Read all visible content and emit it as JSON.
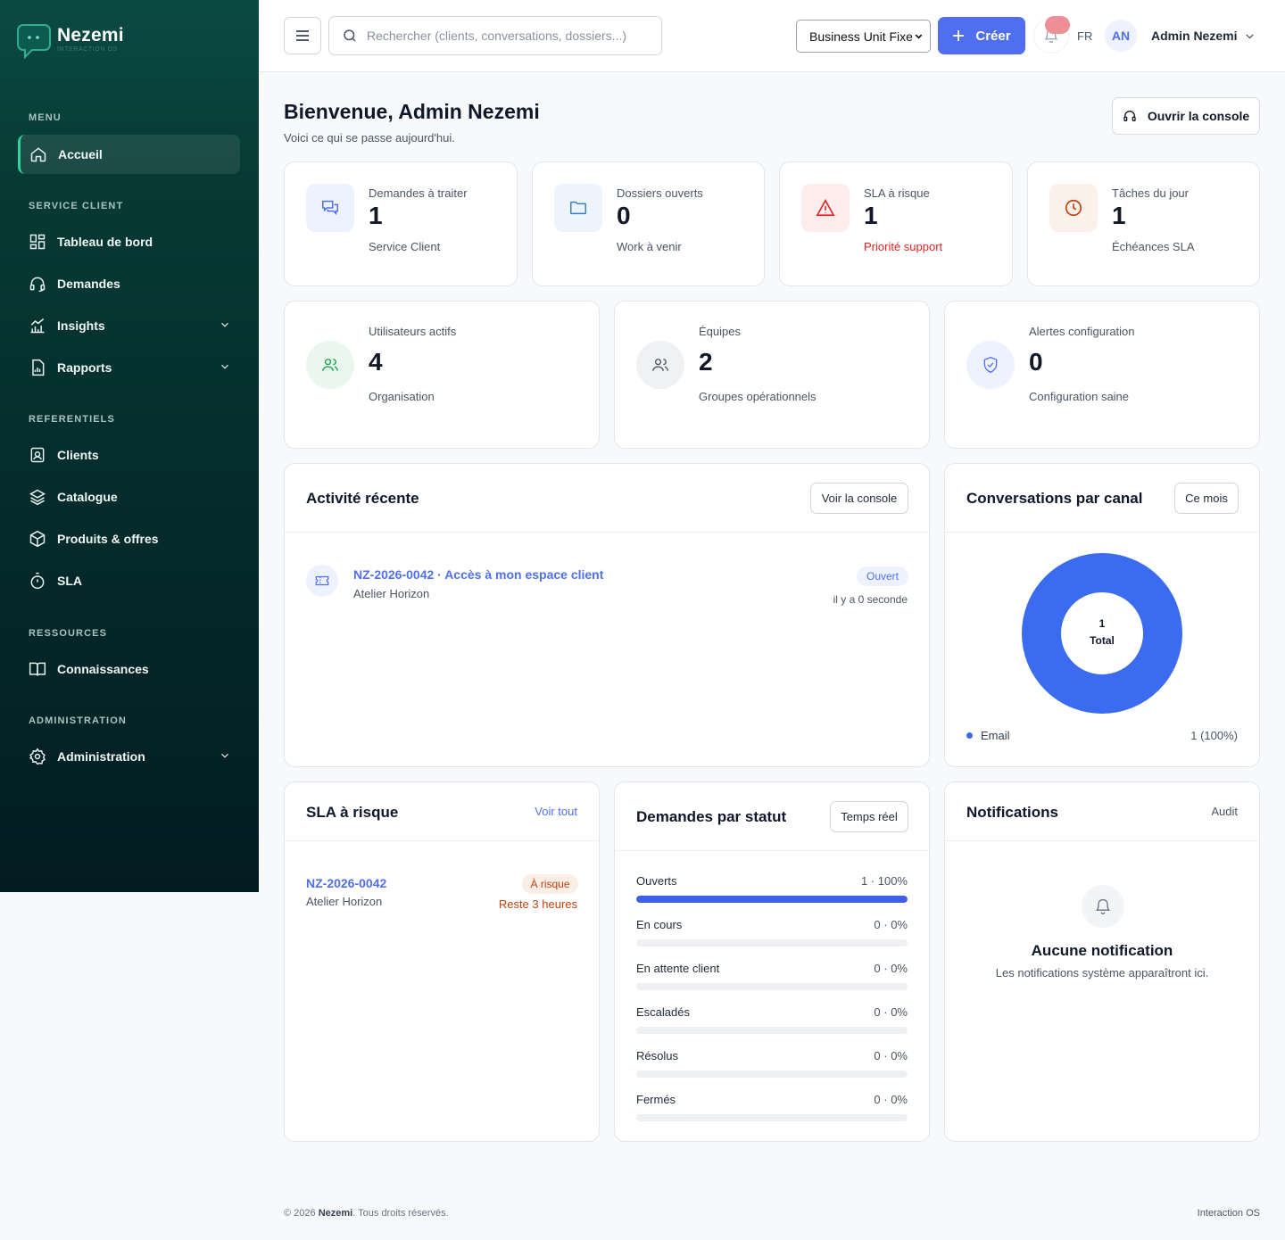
{
  "brand": {
    "name": "Nezemi",
    "tagline": "INTERACTION OS"
  },
  "sidebar": {
    "sections": {
      "menu": "MENU",
      "service": "SERVICE CLIENT",
      "ref": "REFERENTIELS",
      "res": "RESSOURCES",
      "admin": "ADMINISTRATION"
    },
    "items": {
      "accueil": "Accueil",
      "tableau": "Tableau de bord",
      "demandes": "Demandes",
      "insights": "Insights",
      "rapports": "Rapports",
      "clients": "Clients",
      "catalogue": "Catalogue",
      "produits": "Produits & offres",
      "sla": "SLA",
      "connaissances": "Connaissances",
      "administration": "Administration"
    }
  },
  "topbar": {
    "search_placeholder": "Rechercher (clients, conversations, dossiers...)",
    "business_unit": "Business Unit Fixe",
    "create_label": "Créer",
    "lang": "FR",
    "avatar_initials": "AN",
    "user_name": "Admin Nezemi"
  },
  "header": {
    "title": "Bienvenue, Admin Nezemi",
    "subtitle": "Voici ce qui se passe aujourd'hui.",
    "console_label": "Ouvrir la console"
  },
  "stats": [
    {
      "label": "Demandes à traiter",
      "value": "1",
      "sub": "Service Client"
    },
    {
      "label": "Dossiers ouverts",
      "value": "0",
      "sub": "Work à venir"
    },
    {
      "label": "SLA à risque",
      "value": "1",
      "sub": "Priorité support"
    },
    {
      "label": "Tâches du jour",
      "value": "1",
      "sub": "Échéances SLA"
    }
  ],
  "stats2": [
    {
      "label": "Utilisateurs actifs",
      "value": "4",
      "sub": "Organisation"
    },
    {
      "label": "Équipes",
      "value": "2",
      "sub": "Groupes opérationnels"
    },
    {
      "label": "Alertes configuration",
      "value": "0",
      "sub": "Configuration saine"
    }
  ],
  "activity": {
    "title": "Activité récente",
    "button": "Voir la console",
    "item": {
      "title": "NZ-2026-0042 · Accès à mon espace client",
      "client": "Atelier Horizon",
      "status": "Ouvert",
      "time": "il y a 0 seconde"
    }
  },
  "channels": {
    "title": "Conversations par canal",
    "button": "Ce mois",
    "center_value": "1",
    "center_label": "Total",
    "legend": [
      {
        "name": "Email",
        "value": "1 (100%)",
        "color": "#3b6cf0",
        "share": 1
      }
    ]
  },
  "sla": {
    "title": "SLA à risque",
    "link": "Voir tout",
    "item": {
      "id": "NZ-2026-0042",
      "client": "Atelier Horizon",
      "badge": "À risque",
      "remaining": "Reste 3 heures"
    }
  },
  "status": {
    "title": "Demandes par statut",
    "button": "Temps réel",
    "rows": [
      {
        "label": "Ouverts",
        "value": "1 · 100%",
        "pct": 100
      },
      {
        "label": "En cours",
        "value": "0 · 0%",
        "pct": 0
      },
      {
        "label": "En attente client",
        "value": "0 · 0%",
        "pct": 0
      },
      {
        "label": "Escaladés",
        "value": "0 · 0%",
        "pct": 0
      },
      {
        "label": "Résolus",
        "value": "0 · 0%",
        "pct": 0
      },
      {
        "label": "Fermés",
        "value": "0 · 0%",
        "pct": 0
      }
    ]
  },
  "notifications": {
    "title": "Notifications",
    "link": "Audit",
    "empty_title": "Aucune notification",
    "empty_text": "Les notifications système apparaîtront ici."
  },
  "footer": {
    "copyright": "© 2026",
    "brand": "Nezemi",
    "rights": ". Tous droits réservés.",
    "right": "Interaction OS"
  },
  "colors": {
    "accent": "#4f6ff0",
    "sidebar": "#063a35",
    "danger": "#dc2626",
    "warning": "#c2410c",
    "success": "#34d399"
  }
}
